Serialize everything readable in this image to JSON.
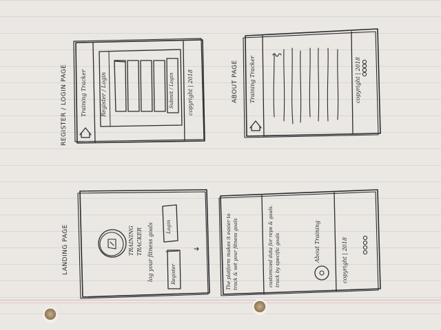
{
  "labels": {
    "register_page": "REGISTER / LOGIN PAGE",
    "about_page": "ABOUT PAGE",
    "landing_page": "LANDING PAGE"
  },
  "register": {
    "app_name": "Training Tracker",
    "form_title": "Register / Login",
    "submit": "Submit / Login",
    "footer": "copyright | 2018"
  },
  "about": {
    "app_name": "Training Tracker",
    "footer": "copyright | 2018"
  },
  "landing": {
    "app_title_1": "TRAINING",
    "app_title_2": "TRACKER",
    "tagline": "log your fitness goals",
    "register_button": "Register",
    "login_button": "Login"
  },
  "landing_scroll": {
    "intro": "The platform makes it easier to track & set your fitness goals",
    "feature": "customized data for reps & goals. track by specific goals",
    "about_link": "About Training",
    "footer": "copyright | 2018"
  },
  "icons": {
    "home": "home-icon",
    "logo": "logo-circle-icon",
    "social": "social-circles-icon",
    "arrow": "arrow-icon"
  }
}
